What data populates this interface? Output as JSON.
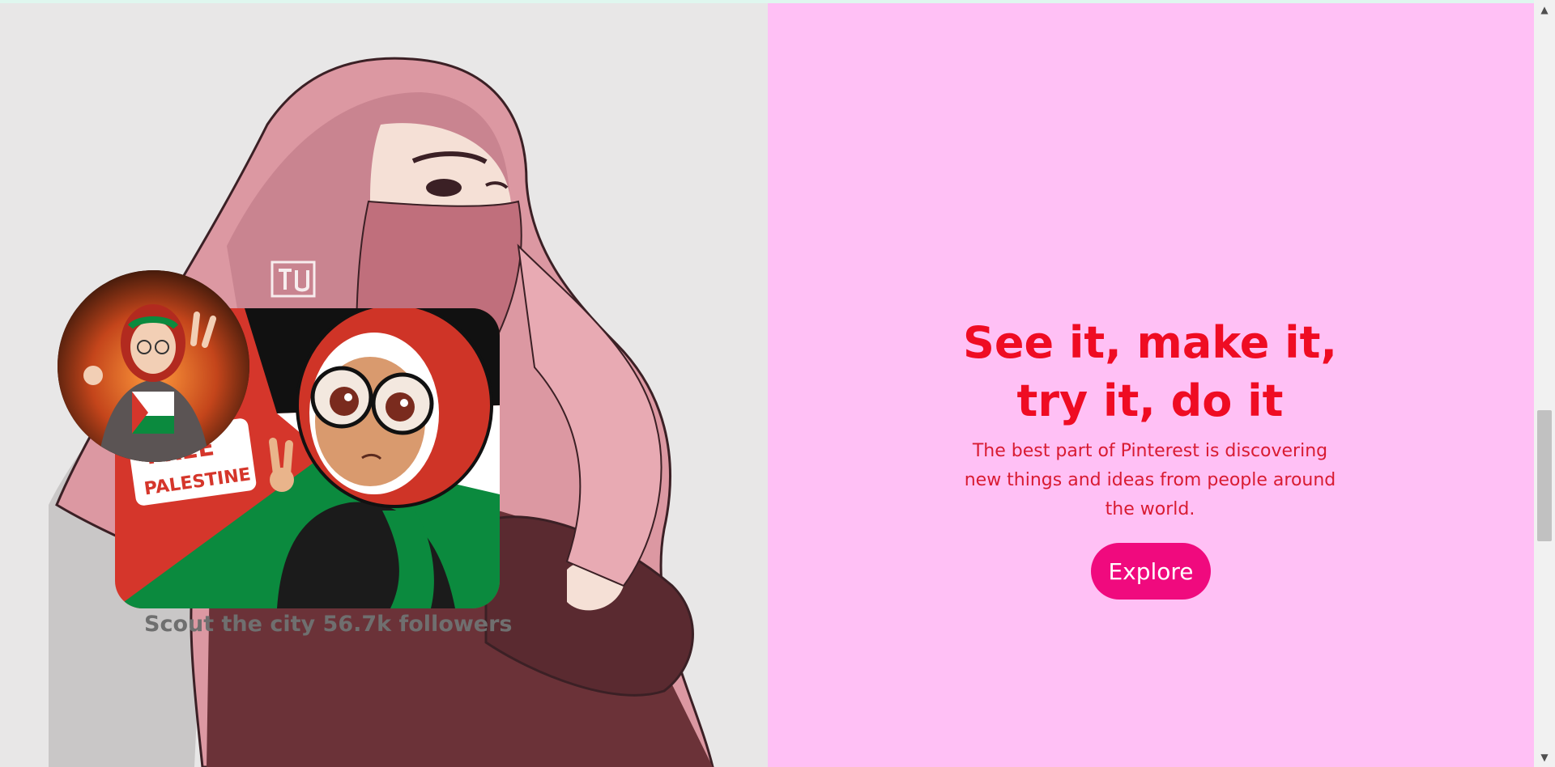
{
  "hero": {
    "headline_line1": "See it, make it,",
    "headline_line2": "try it, do it",
    "description": "The best part of Pinterest is discovering new things and ideas from people around the world.",
    "explore_label": "Explore"
  },
  "board": {
    "caption": "Scout the city 56.7k followers",
    "card_sign_text_line1": "FREE",
    "card_sign_text_line2": "PALESTINE"
  },
  "colors": {
    "left_bg": "#e8e7e7",
    "right_bg": "#ffc0f5",
    "headline": "#ef0c23",
    "button": "#f00a7e",
    "caption": "#6f6f6f"
  },
  "icons": {
    "scroll_up": "triangle-up-icon",
    "scroll_down": "triangle-down-icon",
    "watermark": "artist-logo-icon"
  }
}
